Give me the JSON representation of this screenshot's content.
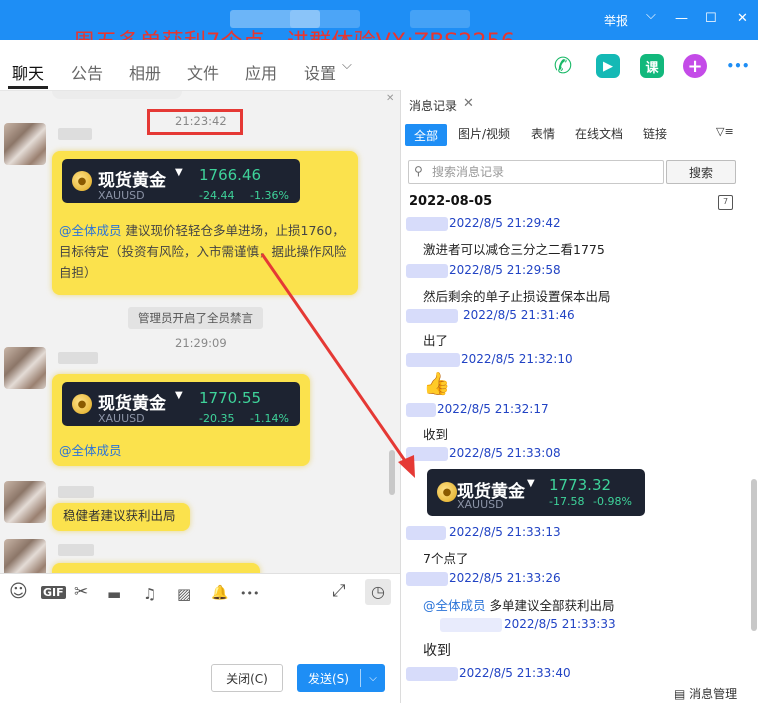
{
  "titlebar": {
    "promo": "周五多单获利7个点，进群体验VX:ZBS2256",
    "report": "举报",
    "chevron": "⌵",
    "minimize": "—",
    "maximize": "☐",
    "close": "✕"
  },
  "tabs": [
    {
      "label": "聊天"
    },
    {
      "label": "公告"
    },
    {
      "label": "相册"
    },
    {
      "label": "文件"
    },
    {
      "label": "应用"
    },
    {
      "label": "设置"
    }
  ],
  "tabs_more_arrow": "⌵",
  "top_icons": {
    "phone": "✆",
    "video": "▶",
    "course": "课",
    "plus": "+",
    "more": "•••"
  },
  "chat": {
    "time1": "21:23:42",
    "card1": {
      "name": "现货黄金",
      "symbol": "XAUUSD",
      "price": "1766.46",
      "change": "-24.44",
      "percent": "-1.36%"
    },
    "msg1_at": "@全体成员",
    "msg1_text": "建议现价轻轻仓多单进场，止损1760，目标待定（投资有风险，入市需谨慎，据此操作风险自担）",
    "system_msg": "管理员开启了全员禁言",
    "time2": "21:29:09",
    "card2": {
      "name": "现货黄金",
      "symbol": "XAUUSD",
      "price": "1770.55",
      "change": "-20.35",
      "percent": "-1.14%"
    },
    "msg2_at": "@全体成员",
    "msg3_text": "稳健者建议获利出局"
  },
  "toolbar": {
    "emoji": "☺",
    "gif": "GIF",
    "cut": "✂",
    "folder": "▬",
    "music": "♫",
    "image": "▨",
    "bell": "🔔",
    "more": "•••",
    "expand": "⤢",
    "history": "◷"
  },
  "buttons": {
    "close": "关闭(C)",
    "send": "发送(S)",
    "send_arrow": "⌵"
  },
  "history": {
    "title": "消息记录",
    "close": "✕",
    "filters": [
      {
        "label": "全部"
      },
      {
        "label": "图片/视频"
      },
      {
        "label": "表情"
      },
      {
        "label": "在线文档"
      },
      {
        "label": "链接"
      }
    ],
    "filter_icon": "▽≡",
    "search_placeholder": "搜索消息记录",
    "search_button": "搜索",
    "date": "2022-08-05",
    "calendar": "7",
    "records": [
      {
        "time": "2022/8/5 21:29:42",
        "text": "激进者可以减仓三分之二看1775"
      },
      {
        "time": "2022/8/5 21:29:58",
        "text": "然后剩余的单子止损设置保本出局"
      },
      {
        "time": "2022/8/5 21:31:46",
        "text": "出了"
      },
      {
        "time": "2022/8/5 21:32:10",
        "text": "👍"
      },
      {
        "time": "2022/8/5 21:32:17",
        "text": "收到"
      },
      {
        "time": "2022/8/5 21:33:08",
        "text": ""
      },
      {
        "time": "2022/8/5 21:33:13",
        "text": "7个点了"
      },
      {
        "time": "2022/8/5 21:33:26",
        "text": "多单建议全部获利出局"
      },
      {
        "time": "2022/8/5 21:33:33",
        "text": "收到"
      },
      {
        "time": "2022/8/5 21:33:40",
        "text": ""
      }
    ],
    "record_at": "@全体成员",
    "card3": {
      "name": "现货黄金",
      "symbol": "XAUUSD",
      "price": "1773.32",
      "change": "-17.58",
      "percent": "-0.98%"
    },
    "footer": "消息管理",
    "footer_icon": "▤"
  },
  "colors": {
    "accent": "#1e8ef5",
    "bubble": "#fbe24d",
    "price_green": "#3ed39a",
    "annotation_red": "#e53935"
  }
}
